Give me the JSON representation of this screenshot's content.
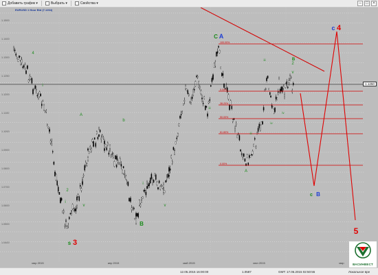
{
  "toolbar": {
    "add_chart_label": "Добавить график",
    "select_label": "Выбрать",
    "properties_label": "Свойства"
  },
  "chart": {
    "symbol_label": "EURUSD 1 Hour Bid (7.1264)",
    "last_price": "1.1250",
    "price_axis_labels": [
      "1.1500",
      "1.1400",
      "1.1300",
      "1.1250",
      "1.1200",
      "1.1100",
      "1.1000",
      "1.0900",
      "1.0800",
      "1.0700",
      "1.0600",
      "1.0500",
      "1.0400"
    ],
    "date_labels": [
      "мар 2015",
      "апр 2015",
      "май 2015",
      "июн 2015",
      "мар"
    ],
    "fib_levels": [
      "100.00%",
      "0.00%",
      "38.20%",
      "50.00%",
      "61.80%",
      "0.00%"
    ],
    "wave_labels": {
      "a": "A",
      "b": "B",
      "c": "C",
      "s3_s": "s",
      "s3_num": "3",
      "b_black": "B",
      "c_blue": "C",
      "a_top": "A",
      "c4_c": "c",
      "c4_num": "4",
      "cb_c": "c",
      "cb_b": "B",
      "five": "5"
    },
    "colors": {
      "background": "#bdbdbd",
      "candles": "#000000",
      "fib": "#d40000",
      "wave_green": "#1a8a1a",
      "wave_blue": "#1f3fd4",
      "wave_red": "#e00000",
      "trendline": "#d40000"
    }
  },
  "status_bar": {
    "datetime": "12.05.2015 16:00:00",
    "price": "1.0587",
    "server_time": "GMT: 17.06.2015 02:50:55",
    "local_time": "Локальное вре"
  },
  "logo": {
    "text": "ВАСИНВЕСТ",
    "icon": "vasinvest-logo-icon"
  }
}
